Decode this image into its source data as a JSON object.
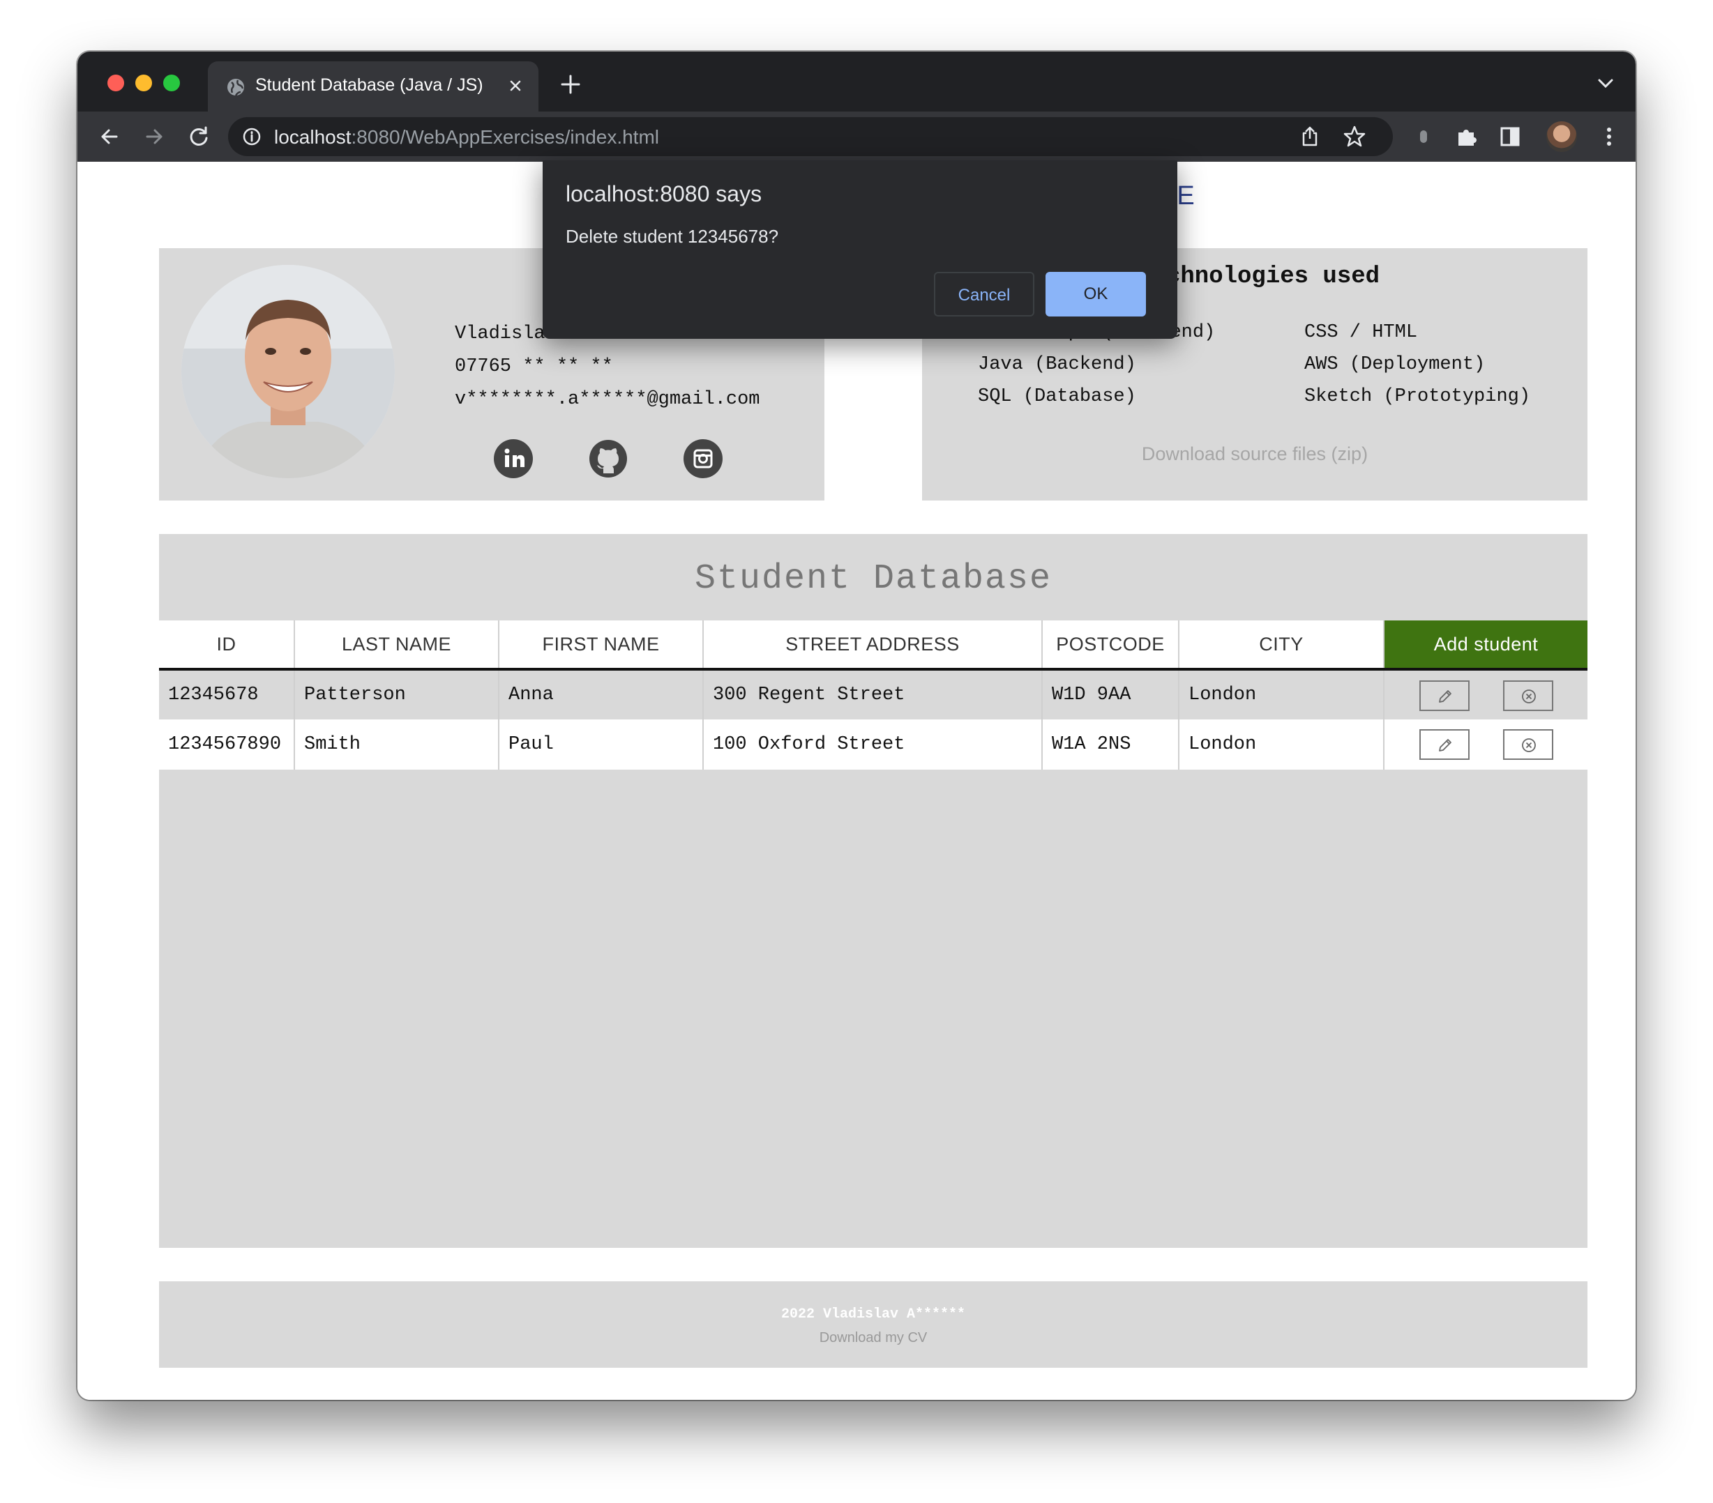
{
  "browser": {
    "tab_title": "Student Database (Java / JS)",
    "url_host": "localhost",
    "url_rest": ":8080/WebAppExercises/index.html"
  },
  "page": {
    "title_visible": "SE"
  },
  "contact": {
    "name": "Vladislav A",
    "phone": "07765 ** ** **",
    "email": "v********.a******@gmail.com"
  },
  "tech": {
    "title": "chnologies used",
    "items": [
      "Javascript (Frontend)",
      "CSS / HTML",
      "Java (Backend)",
      "AWS (Deployment)",
      "SQL (Database)",
      "Sketch (Prototyping)"
    ],
    "download": "Download source files (zip)"
  },
  "database": {
    "title": "Student Database",
    "columns": [
      "ID",
      "LAST NAME",
      "FIRST NAME",
      "STREET ADDRESS",
      "POSTCODE",
      "CITY"
    ],
    "add_button": "Add student",
    "rows": [
      [
        "12345678",
        "Patterson",
        "Anna",
        "300 Regent Street",
        "W1D 9AA",
        "London"
      ],
      [
        "1234567890",
        "Smith",
        "Paul",
        "100 Oxford Street",
        "W1A 2NS",
        "London"
      ]
    ]
  },
  "footer": {
    "name": "2022 Vladislav A******",
    "cv": "Download my CV"
  },
  "dialog": {
    "title": "localhost:8080 says",
    "message": "Delete student 12345678?",
    "cancel": "Cancel",
    "ok": "OK"
  }
}
